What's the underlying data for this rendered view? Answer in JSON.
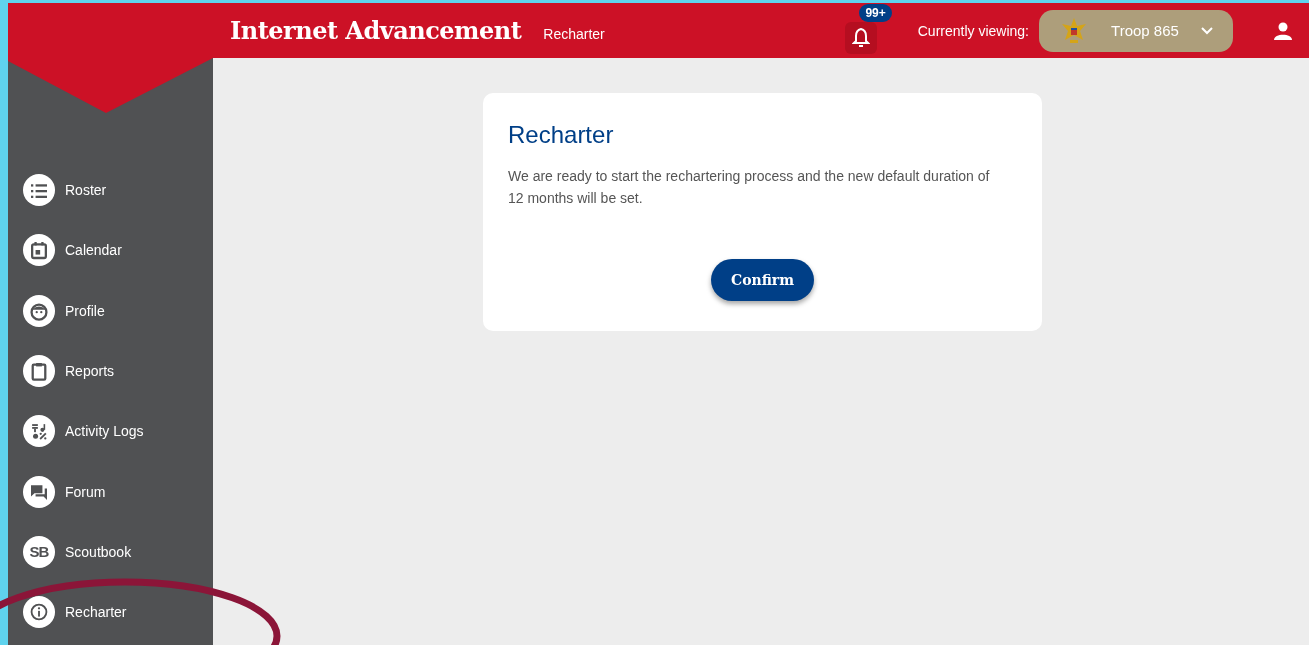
{
  "header": {
    "title": "Internet Advancement",
    "subtitle": "Recharter",
    "notifications": {
      "badge": "99+"
    },
    "viewing_label": "Currently viewing:",
    "unit_selector": {
      "value": "Troop 865"
    }
  },
  "sidebar": {
    "items": [
      {
        "label": "Roster"
      },
      {
        "label": "Calendar"
      },
      {
        "label": "Profile"
      },
      {
        "label": "Reports"
      },
      {
        "label": "Activity Logs"
      },
      {
        "label": "Forum"
      },
      {
        "label": "Scoutbook",
        "badge": "SB"
      },
      {
        "label": "Recharter"
      }
    ]
  },
  "card": {
    "title": "Recharter",
    "text": "We are ready to start the rechartering process and the new default duration of 12 months will be set.",
    "button": "Confirm"
  }
}
